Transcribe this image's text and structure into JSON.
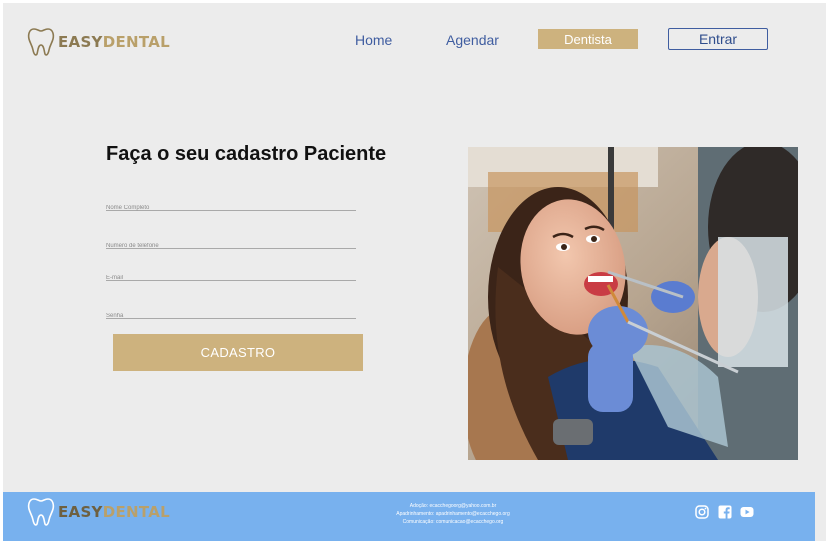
{
  "header": {
    "logo": {
      "part1": "EASY",
      "part2": "DENTAL"
    },
    "nav": {
      "home": "Home",
      "agendar": "Agendar",
      "dentista": "Dentista",
      "entrar": "Entrar"
    }
  },
  "form": {
    "title": "Faça o seu cadastro Paciente",
    "fields": [
      {
        "placeholder": "Nome Completo"
      },
      {
        "placeholder": "Numero de telefone"
      },
      {
        "placeholder": "E-mail"
      },
      {
        "placeholder": "Senha"
      }
    ],
    "submit_label": "CADASTRO"
  },
  "footer": {
    "logo": {
      "part1": "EASY",
      "part2": "DENTAL"
    },
    "contacts": [
      "Adoção: ecacchegoorg@yahoo.com.br",
      "Apadrinhamento: apadrinhamento@ecacchego.org",
      "Comunicação: comunicacao@ecacchego.org"
    ],
    "social_icons": [
      "instagram-icon",
      "facebook-icon",
      "youtube-icon"
    ]
  },
  "colors": {
    "gold": "#cdb27e",
    "nav_blue": "#3f5da0",
    "footer_blue": "#78b1ee",
    "page_bg": "#ececec"
  }
}
